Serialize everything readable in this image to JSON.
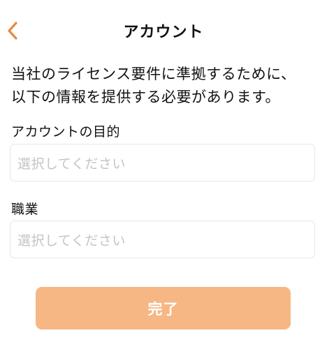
{
  "header": {
    "title": "アカウント"
  },
  "intro": {
    "line1": "当社のライセンス要件に準拠するために、",
    "line2": "以下の情報を提供する必要があります。"
  },
  "form": {
    "purpose": {
      "label": "アカウントの目的",
      "placeholder": "選択してください"
    },
    "occupation": {
      "label": "職業",
      "placeholder": "選択してください"
    }
  },
  "done_button": {
    "label": "完了"
  },
  "colors": {
    "accent": "#e8893f",
    "button_bg": "#f6b785",
    "placeholder": "#c4c4c4",
    "border": "#e6e6e6"
  },
  "icons": {
    "back": "chevron-left-icon"
  }
}
